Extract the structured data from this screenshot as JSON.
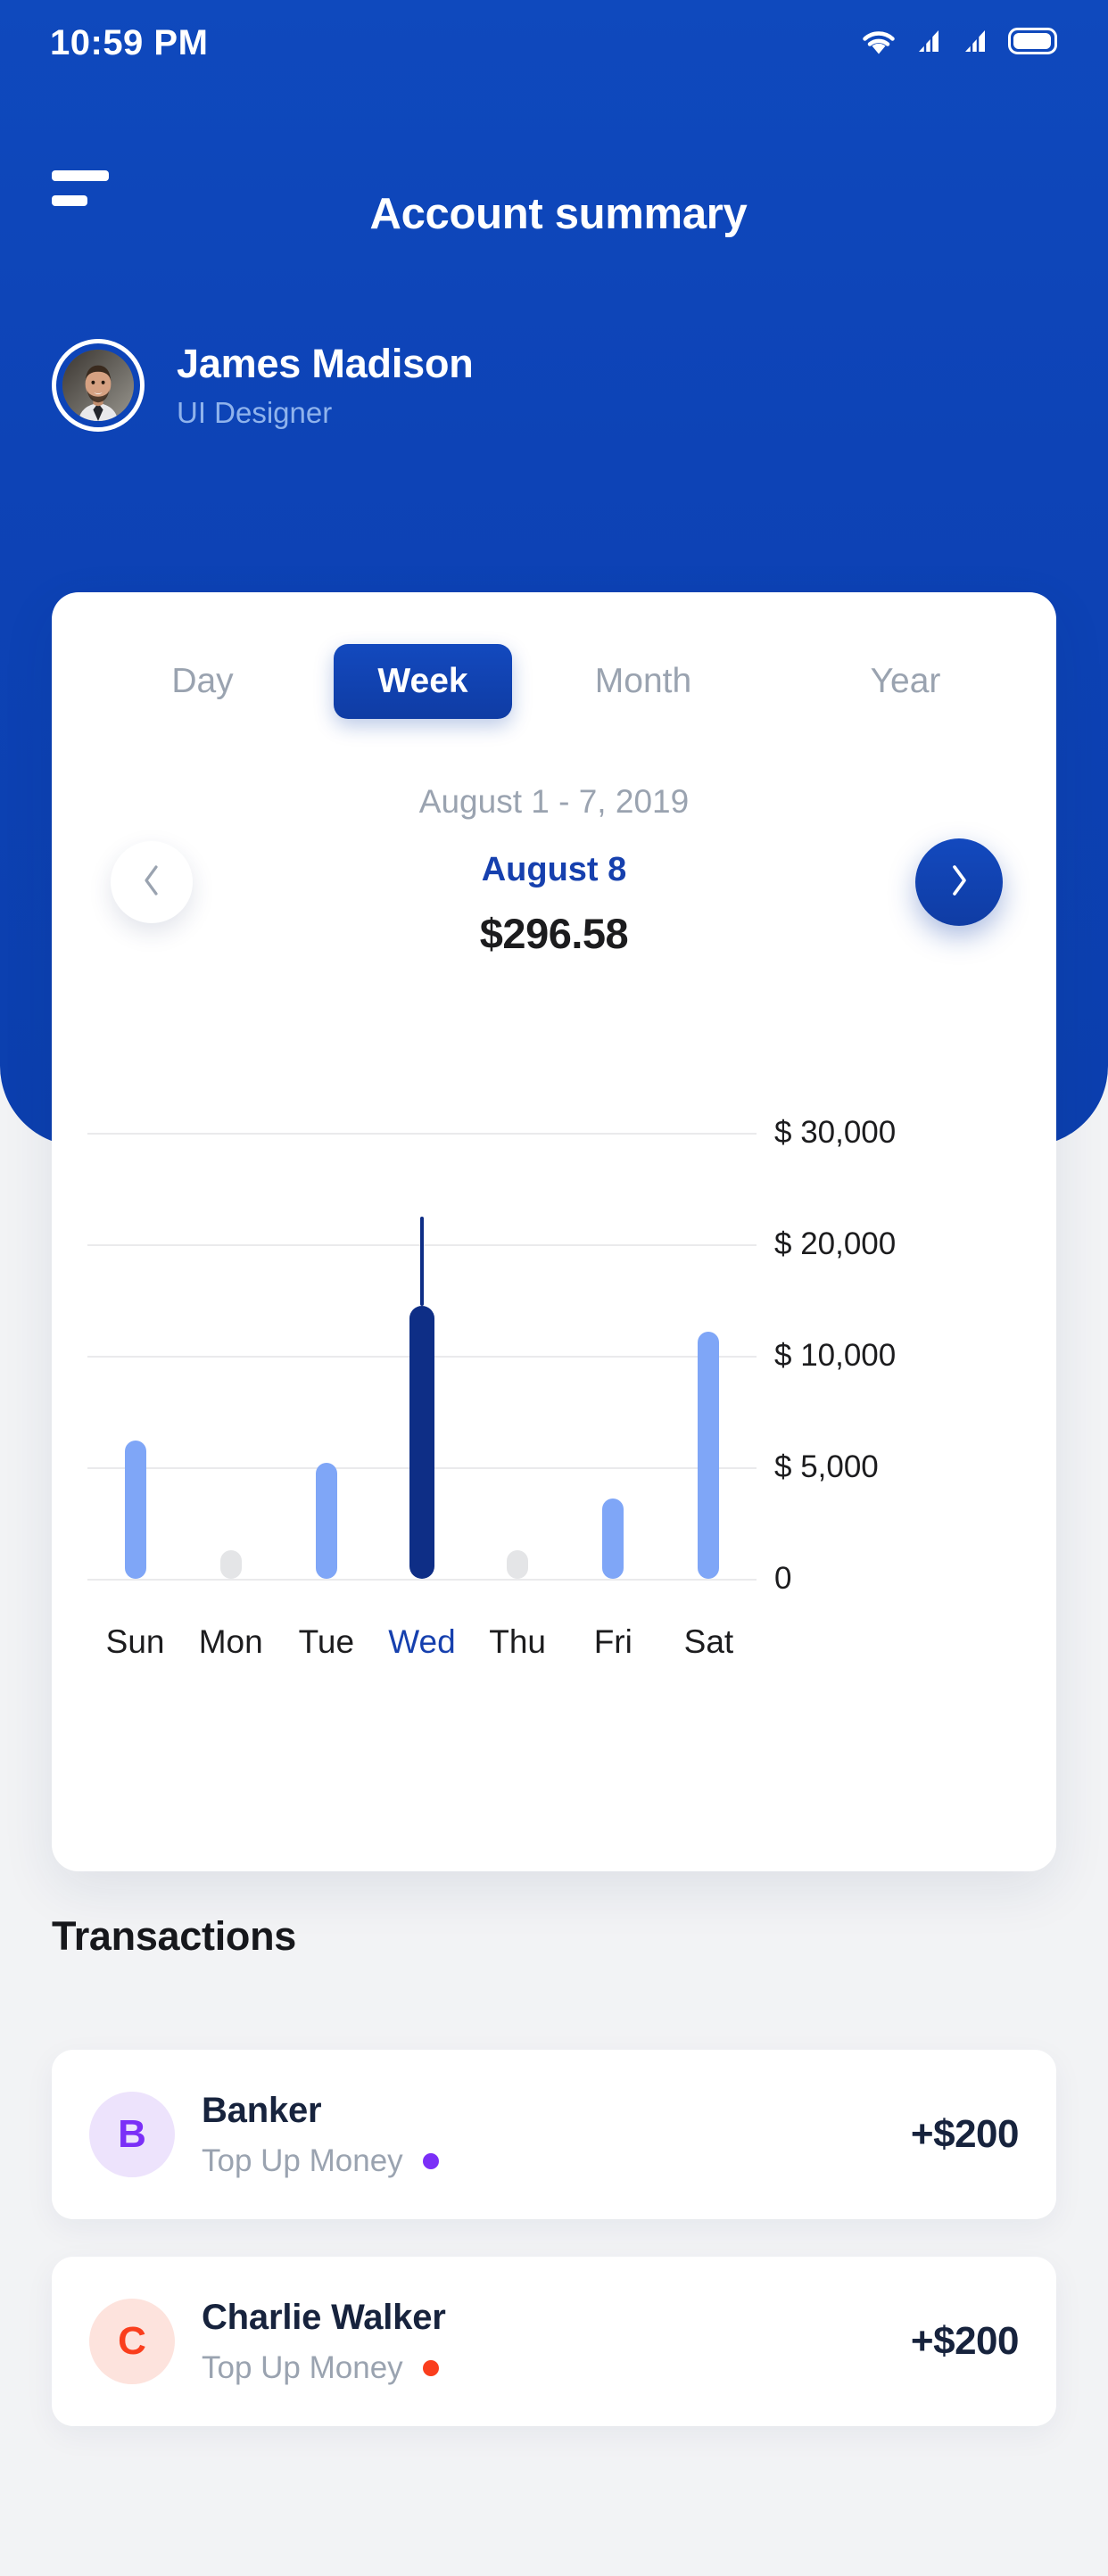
{
  "status_bar": {
    "time": "10:59 PM",
    "icons": [
      "wifi-icon",
      "signal-icon",
      "signal-icon",
      "battery-icon"
    ]
  },
  "nav": {
    "menu_icon": "hamburger-menu-icon",
    "title": "Account summary"
  },
  "profile": {
    "name": "James Madison",
    "role": "UI Designer",
    "avatar": "user-photo-avatar"
  },
  "period_tabs": {
    "items": [
      {
        "label": "Day",
        "active": false
      },
      {
        "label": "Week",
        "active": true
      },
      {
        "label": "Month",
        "active": false
      },
      {
        "label": "Year",
        "active": false
      }
    ],
    "active_color": "#103FA8"
  },
  "period": {
    "range": "August 1 - 7, 2019",
    "day": "August 8",
    "amount": "$296.58",
    "prev_icon": "chevron-left-icon",
    "next_icon": "chevron-right-icon"
  },
  "chart_data": {
    "type": "bar",
    "title": "",
    "xlabel": "",
    "ylabel": "",
    "categories": [
      "Sun",
      "Mon",
      "Tue",
      "Wed",
      "Thu",
      "Fri",
      "Sat"
    ],
    "values": [
      6200,
      1300,
      5200,
      14500,
      1300,
      3600,
      12200
    ],
    "tick_labels": [
      "$ 30,000",
      "$ 20,000",
      "$ 10,000",
      "$ 5,000",
      "0"
    ],
    "tick_values": [
      30000,
      20000,
      10000,
      5000,
      0
    ],
    "highlight_category": "Wed",
    "highlight_spike_value": 22500,
    "grid": true,
    "legend": "none",
    "colors": {
      "bar": "#7FA6F7",
      "bar_muted": "#E4E5E7",
      "bar_highlight": "#0E2E86",
      "gridline": "#EAEAEC",
      "label": "#1C1C1E",
      "label_active": "#1640AE"
    },
    "bar_states": [
      "normal",
      "muted",
      "normal",
      "highlight",
      "muted",
      "normal",
      "normal"
    ]
  },
  "transactions": {
    "title": "Transactions",
    "items": [
      {
        "initial": "B",
        "name": "Banker",
        "subtitle": "Top Up Money",
        "amount": "+$200",
        "dot_color": "#7B2FF7",
        "avatar_bg": "#EDE3FC",
        "avatar_fg": "#7B2FF7"
      },
      {
        "initial": "C",
        "name": "Charlie Walker",
        "subtitle": "Top Up Money",
        "amount": "+$200",
        "dot_color": "#FA3E1D",
        "avatar_bg": "#FDE3DD",
        "avatar_fg": "#FA3E1D"
      }
    ]
  },
  "theme": {
    "header_blue": "#0D43B6",
    "body_bg": "#F2F3F5",
    "accent": "#1640AE"
  }
}
